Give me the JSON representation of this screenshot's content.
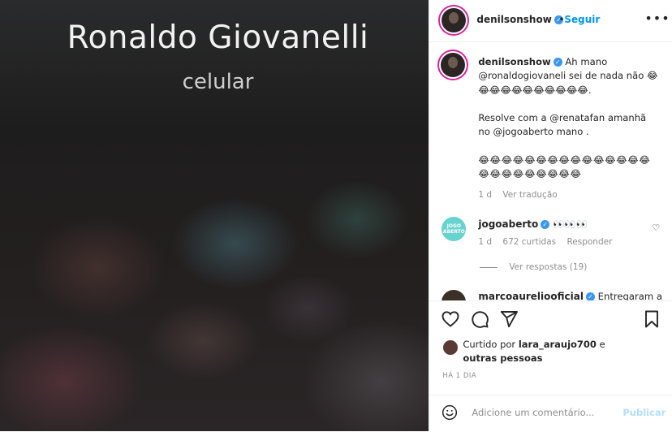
{
  "media": {
    "caller_name": "Ronaldo  Giovanelli",
    "caller_label": "celular"
  },
  "header": {
    "username": "denilsonshow",
    "separator": "•",
    "follow_label": "Seguir",
    "more_label": "•••"
  },
  "caption": {
    "username": "denilsonshow",
    "line1": "Ah mano @ronaldogiovaneli sei de nada não 😂😂😂😂😂😂😂😂😂😂😂.",
    "line2": "Resolve com a @renatafan amanhã no @jogoaberto mano .",
    "emojis": "😂😂😂😂😂😂😂😂😂😂😂😂😂😂😂😂😂😂😂😂😂😂😂😂",
    "time": "1 d",
    "translate_label": "Ver tradução"
  },
  "reply": {
    "avatar_text": "JOGO ABERTO",
    "username": "jogoaberto",
    "text": "👀👀👀",
    "time": "1 d",
    "likes": "672 curtidas",
    "reply_label": "Responder",
    "view_replies": "Ver respostas (19)"
  },
  "next_comment": {
    "username": "marcoaureliooficial",
    "text": "Entregaram a"
  },
  "likes": {
    "prefix": "Curtido por",
    "user": "lara_araujo700",
    "and": "e",
    "others": "outras pessoas"
  },
  "time_ago": "HÁ 1 DIA",
  "comment_box": {
    "placeholder": "Adicione um comentário...",
    "publish_label": "Publicar"
  },
  "colors": {
    "accent": "#0095f6",
    "verified": "#3897f0",
    "jogo_avatar": "#67d3cf"
  }
}
